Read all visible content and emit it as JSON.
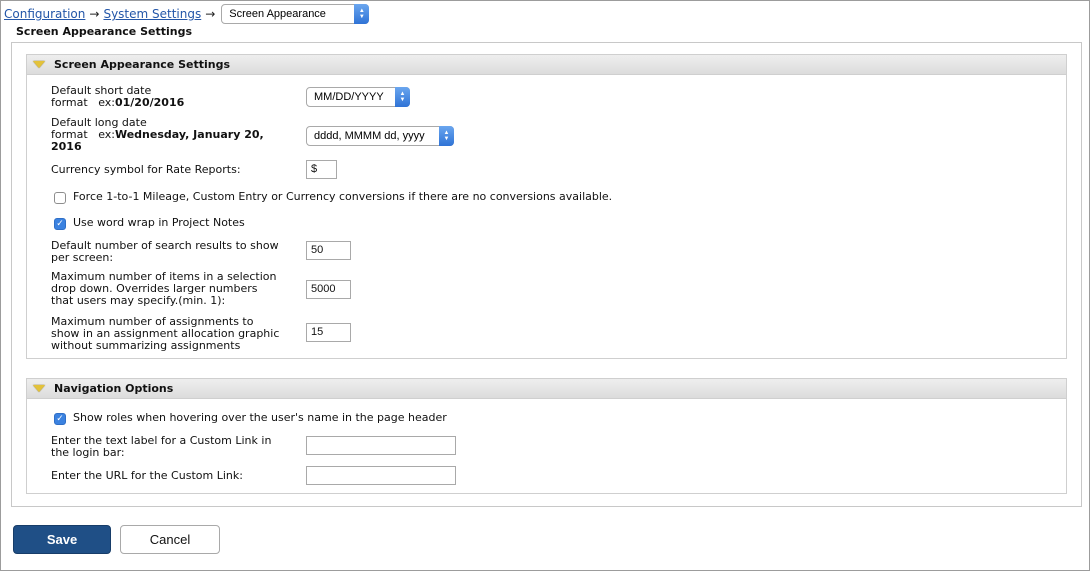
{
  "breadcrumb": {
    "items": [
      "Configuration",
      "System Settings"
    ],
    "separator": "→",
    "current": "Screen Appearance"
  },
  "page_title": "Screen Appearance Settings",
  "appearance": {
    "header": "Screen Appearance Settings",
    "short_date": {
      "label": "Default short date",
      "label2": "format   ex:",
      "example": "01/20/2016",
      "value": "MM/DD/YYYY"
    },
    "long_date": {
      "label": "Default long date",
      "label2": "format   ex:",
      "example": "Wednesday, January 20,",
      "example2": "2016",
      "value": "dddd, MMMM dd, yyyy"
    },
    "currency": {
      "label": "Currency symbol for Rate Reports:",
      "value": "$"
    },
    "force_conversion": {
      "label": "Force 1-to-1 Mileage, Custom Entry or Currency conversions if there are no conversions available.",
      "checked": false
    },
    "word_wrap": {
      "label": "Use word wrap in Project Notes",
      "checked": true
    },
    "search_results": {
      "line1": "Default number of search results to show",
      "line2": "per screen:",
      "value": "50"
    },
    "max_items": {
      "line1": "Maximum number of items in a selection",
      "line2": "drop down. Overrides larger numbers",
      "line3": "that users may specify.(min. 1):",
      "value": "5000"
    },
    "max_assignments": {
      "line1": "Maximum number of assignments to",
      "line2": "show in an assignment allocation graphic",
      "line3": "without summarizing assignments",
      "value": "15"
    }
  },
  "navigation": {
    "header": "Navigation Options",
    "show_roles": {
      "label": "Show roles when hovering over the user's name in the page header",
      "checked": true
    },
    "custom_link_label": {
      "line1": "Enter the text label for a Custom Link in",
      "line2": "the login bar:",
      "value": ""
    },
    "custom_link_url": {
      "label": "Enter the URL for the Custom Link:",
      "value": ""
    }
  },
  "buttons": {
    "save": "Save",
    "cancel": "Cancel"
  },
  "colors": {
    "link": "#2356a8",
    "save_bg": "#1f4f86",
    "checkbox_on": "#3b82e0",
    "section_icon": "#e3c23a"
  }
}
